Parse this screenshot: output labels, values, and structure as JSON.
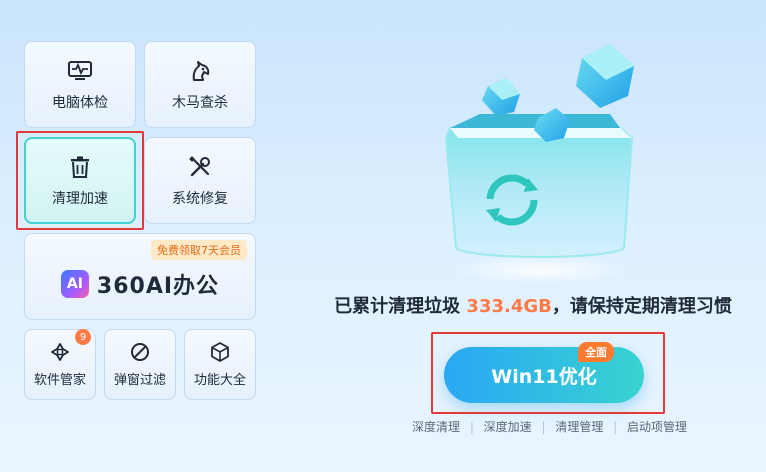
{
  "tiles": {
    "pc_check": "电脑体检",
    "trojan_scan": "木马查杀",
    "cleanup_speedup": "清理加速",
    "system_repair": "系统修复"
  },
  "promo": {
    "tag": "免费领取7天会员",
    "logo_badge": "AI",
    "logo_text": "360AI办公"
  },
  "small_tiles": {
    "software_manager": "软件管家",
    "software_manager_badge": "9",
    "popup_filter": "弹窗过滤",
    "feature_hub": "功能大全"
  },
  "main": {
    "headline_prefix": "已累计清理垃圾",
    "headline_size": "333.4GB",
    "headline_suffix": "，请保持定期清理习惯",
    "button_label": "Win11优化",
    "button_badge": "全面",
    "links": [
      "深度清理",
      "深度加速",
      "清理管理",
      "启动项管理"
    ]
  },
  "colors": {
    "accent_teal": "#38d3d0",
    "accent_blue": "#2aa7f5",
    "highlight_orange": "#ff7a45",
    "selection_red": "#e23a3a"
  }
}
